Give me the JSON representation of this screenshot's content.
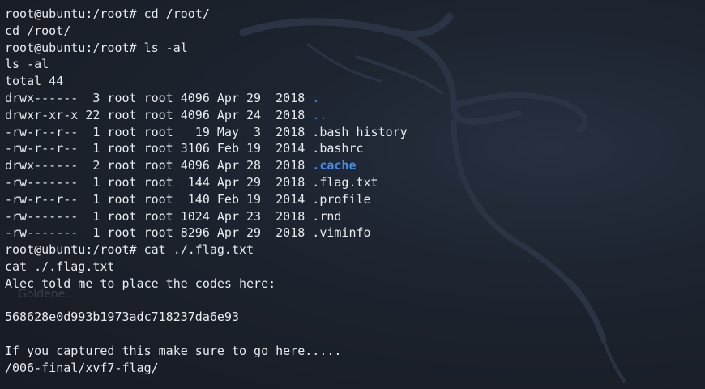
{
  "background_icons": {
    "watermark": "kali-dragon-icon"
  },
  "colors": {
    "background": "#1b202a",
    "text": "#e8ebef",
    "directory": "#3f8cf0"
  },
  "desktop_ghost_label": "Goldene...",
  "terminal": {
    "lines": [
      {
        "kind": "plain",
        "text": "root@ubuntu:/root# cd /root/"
      },
      {
        "kind": "plain",
        "text": "cd /root/"
      },
      {
        "kind": "plain",
        "text": "root@ubuntu:/root# ls -al"
      },
      {
        "kind": "plain",
        "text": "ls -al"
      },
      {
        "kind": "plain",
        "text": "total 44"
      },
      {
        "kind": "entry",
        "prefix": "drwx------  3 root root 4096 Apr 29  2018 ",
        "name": ".",
        "dir": true
      },
      {
        "kind": "entry",
        "prefix": "drwxr-xr-x 22 root root 4096 Apr 24  2018 ",
        "name": "..",
        "dir": true
      },
      {
        "kind": "entry",
        "prefix": "-rw-r--r--  1 root root   19 May  3  2018 ",
        "name": ".bash_history",
        "dir": false
      },
      {
        "kind": "entry",
        "prefix": "-rw-r--r--  1 root root 3106 Feb 19  2014 ",
        "name": ".bashrc",
        "dir": false
      },
      {
        "kind": "entry",
        "prefix": "drwx------  2 root root 4096 Apr 28  2018 ",
        "name": ".cache",
        "dir": true
      },
      {
        "kind": "entry",
        "prefix": "-rw-------  1 root root  144 Apr 29  2018 ",
        "name": ".flag.txt",
        "dir": false
      },
      {
        "kind": "entry",
        "prefix": "-rw-r--r--  1 root root  140 Feb 19  2014 ",
        "name": ".profile",
        "dir": false
      },
      {
        "kind": "entry",
        "prefix": "-rw-------  1 root root 1024 Apr 23  2018 ",
        "name": ".rnd",
        "dir": false
      },
      {
        "kind": "entry",
        "prefix": "-rw-------  1 root root 8296 Apr 29  2018 ",
        "name": ".viminfo",
        "dir": false
      },
      {
        "kind": "plain",
        "text": "root@ubuntu:/root# cat ./.flag.txt"
      },
      {
        "kind": "plain",
        "text": "cat ./.flag.txt"
      },
      {
        "kind": "plain",
        "text": "Alec told me to place the codes here:"
      },
      {
        "kind": "plain",
        "text": ""
      },
      {
        "kind": "plain",
        "text": "568628e0d993b1973adc718237da6e93"
      },
      {
        "kind": "plain",
        "text": ""
      },
      {
        "kind": "plain",
        "text": "If you captured this make sure to go here....."
      },
      {
        "kind": "plain",
        "text": "/006-final/xvf7-flag/"
      }
    ]
  }
}
